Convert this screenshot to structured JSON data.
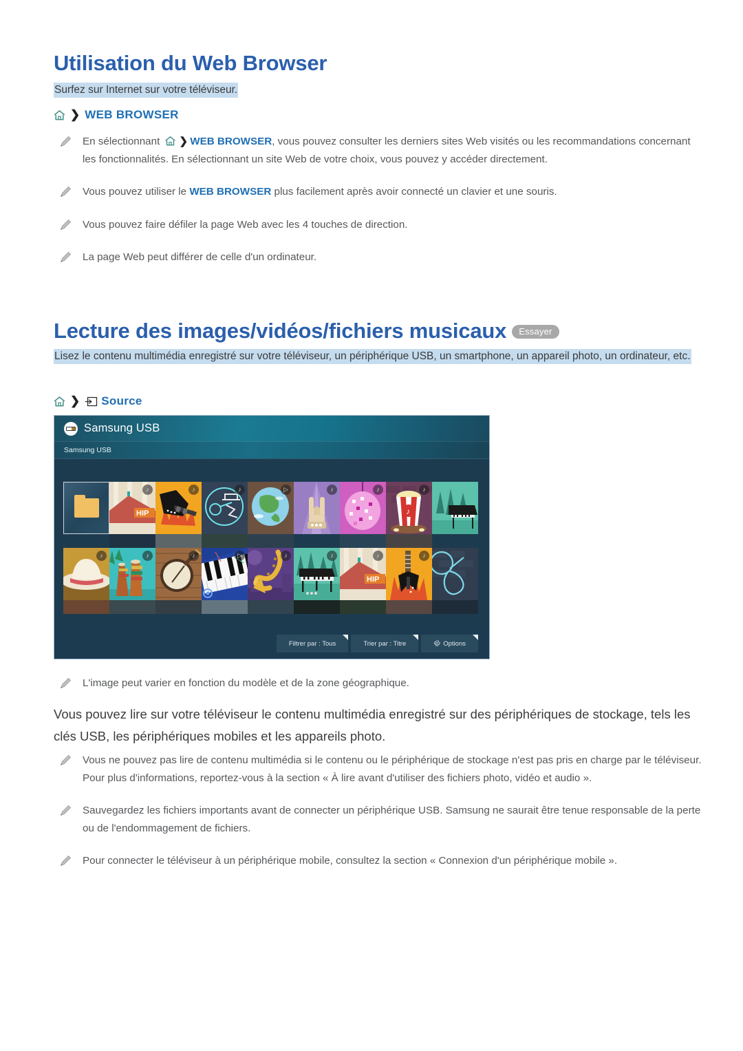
{
  "document": {
    "language": "fr"
  },
  "sections": [
    {
      "id": "web-browser",
      "title": "Utilisation du Web Browser",
      "lead": "Surfez sur Internet sur votre téléviseur.",
      "breadcrumb": {
        "home_icon": "home-icon",
        "separator": "❯",
        "label": "WEB BROWSER"
      },
      "bullets": [
        "En sélectionnant ⌂ ❯ WEB BROWSER, vous pouvez consulter les derniers sites Web visités ou les recommandations concernant les fonctionnalités. En sélectionnant un site Web de votre choix, vous pouvez y accéder directement.",
        "Vous pouvez utiliser le WEB BROWSER plus facilement après avoir connecté un clavier et une souris.",
        "Vous pouvez faire défiler la page Web avec les 4 touches de direction.",
        "La page Web peut différer de celle d'un ordinateur."
      ],
      "bullet_parts": {
        "b1_a": "En sélectionnant ",
        "b1_bold": "WEB BROWSER",
        "b1_b": ", vous pouvez consulter les derniers sites Web visités ou les recommandations concernant les fonctionnalités. En sélectionnant un site Web de votre choix, vous pouvez y accéder directement.",
        "b2_a": "Vous pouvez utiliser le ",
        "b2_bold": "WEB BROWSER",
        "b2_b": " plus facilement après avoir connecté un clavier et une souris.",
        "b3": "Vous pouvez faire défiler la page Web avec les 4 touches de direction.",
        "b4": "La page Web peut différer de celle d'un ordinateur."
      }
    },
    {
      "id": "media-playback",
      "title": "Lecture des images/vidéos/fichiers musicaux",
      "badge": "Essayer",
      "lead": "Lisez le contenu multimédia enregistré sur votre téléviseur, un périphérique USB, un smartphone, un appareil photo, un ordinateur, etc.",
      "breadcrumb": {
        "home_icon": "home-icon",
        "separator": "❯",
        "source_icon": "source-input-icon",
        "label": "Source"
      },
      "note": "L'image peut varier en fonction du modèle et de la zone géographique.",
      "paragraph": "Vous pouvez lire sur votre téléviseur le contenu multimédia enregistré sur des périphériques de stockage, tels les clés USB, les périphériques mobiles et les appareils photo.",
      "bullets": [
        "Vous ne pouvez pas lire de contenu multimédia si le contenu ou le périphérique de stockage n'est pas pris en charge par le téléviseur. Pour plus d'informations, reportez-vous à la section « À lire avant d'utiliser des fichiers photo, vidéo et audio ».",
        "Sauvegardez les fichiers importants avant de connecter un périphérique USB. Samsung ne saurait être tenue responsable de la perte ou de l'endommagement de fichiers.",
        "Pour connecter le téléviseur à un périphérique mobile, consultez la section « Connexion d'un périphérique mobile »."
      ]
    }
  ],
  "tv_screenshot": {
    "header_title": "Samsung USB",
    "header_icon": "usb-device-icon",
    "subbar_title": "Samsung USB",
    "footer_buttons": [
      {
        "label": "Filtrer par : Tous",
        "icon": null
      },
      {
        "label": "Trier par : Titre",
        "icon": null
      },
      {
        "label": "Options",
        "icon": "gear-icon"
      }
    ],
    "grid": {
      "rows": 2,
      "columns": 9,
      "row1": [
        {
          "type": "folder",
          "badge": null
        },
        {
          "type": "house-hip",
          "badge": "♪"
        },
        {
          "type": "flame-guitar",
          "badge": "♪"
        },
        {
          "type": "neon-detective",
          "badge": "♪"
        },
        {
          "type": "globe",
          "badge": "▷"
        },
        {
          "type": "rock-hand",
          "badge": "♪"
        },
        {
          "type": "disco-ball",
          "badge": "♪"
        },
        {
          "type": "popcorn",
          "badge": "♪"
        },
        {
          "type": "piano-forest",
          "badge": null
        }
      ],
      "row2": [
        {
          "type": "cowboy-hat",
          "badge": "♪"
        },
        {
          "type": "congas",
          "badge": "♪"
        },
        {
          "type": "banjo",
          "badge": "♪"
        },
        {
          "type": "piano-keys",
          "badge": "▷"
        },
        {
          "type": "saxophone",
          "badge": "♪"
        },
        {
          "type": "grand-piano",
          "badge": "♪"
        },
        {
          "type": "house-hip-2",
          "badge": "♪"
        },
        {
          "type": "flame-guitar-2",
          "badge": "♪"
        },
        {
          "type": "neon-guitar",
          "badge": null
        }
      ]
    }
  },
  "colors": {
    "heading": "#2b5fad",
    "link": "#1f6fb5",
    "highlight": "#c5dcef",
    "badge_gray": "#a8a8a8",
    "body_text": "#55575a",
    "tv_bg": "#1d3b4f",
    "tv_header_teal": "#1b7b93"
  }
}
